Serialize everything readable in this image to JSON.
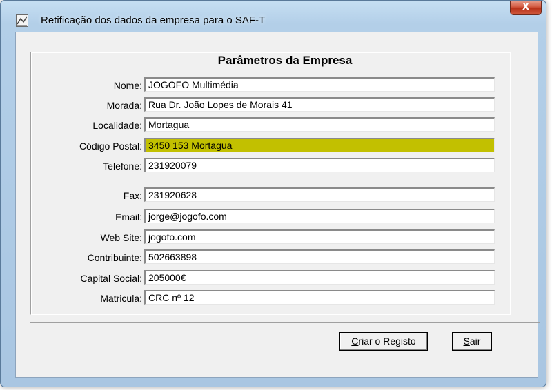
{
  "window": {
    "title": "Retificação dos dados da empresa para o SAF-T",
    "close_glyph": "X",
    "app_icon": "app-chart-icon"
  },
  "panel": {
    "title": "Parâmetros da Empresa"
  },
  "fields": [
    {
      "label": "Nome:",
      "value": "JOGOFO Multimédia"
    },
    {
      "label": "Morada:",
      "value": "Rua Dr. João Lopes de Morais 41"
    },
    {
      "label": "Localidade:",
      "value": "Mortagua"
    },
    {
      "label": "Código Postal:",
      "value": "3450 153 Mortagua",
      "highlighted": true
    },
    {
      "label": "Telefone:",
      "value": "231920079"
    },
    {
      "label": "Fax:",
      "value": "231920628"
    },
    {
      "label": "Email:",
      "value": "jorge@jogofo.com"
    },
    {
      "label": "Web Site:",
      "value": "jogofo.com"
    },
    {
      "label": "Contribuinte:",
      "value": "502663898"
    },
    {
      "label": "Capital Social:",
      "value": "205000€"
    },
    {
      "label": "Matricula:",
      "value": "CRC nº 12"
    }
  ],
  "buttons": {
    "create_mnemonic": "C",
    "create_rest": "riar o Registo",
    "exit_mnemonic": "S",
    "exit_rest": "air"
  },
  "colors": {
    "highlight": "#c2c000",
    "close": "#c8462b"
  }
}
